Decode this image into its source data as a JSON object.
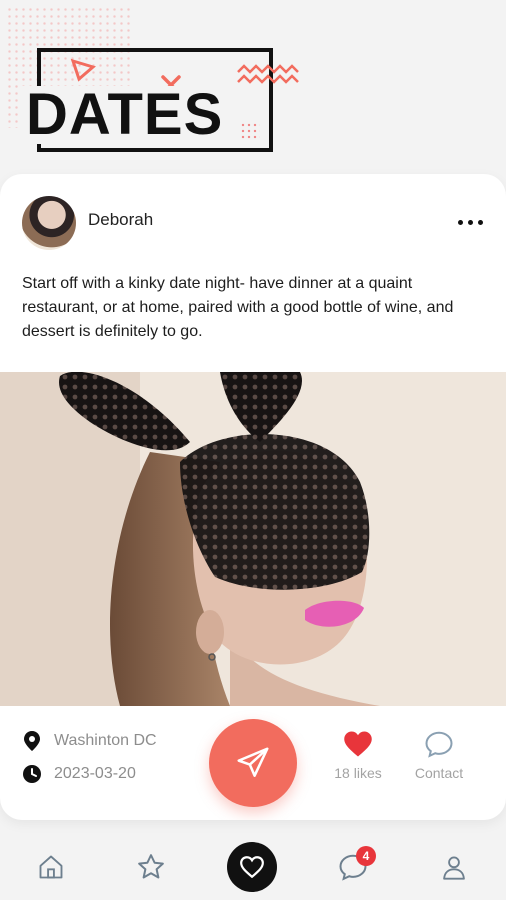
{
  "header": {
    "title": "DATES"
  },
  "post": {
    "author": "Deborah",
    "text": "Start off with a kinky date night- have dinner at a quaint restaurant, or at home, paired with a good bottle of wine, and dessert is definitely to go.",
    "location": "Washinton DC",
    "date": "2023-03-20",
    "likes_label": "18 likes",
    "contact_label": "Contact"
  },
  "nav": {
    "messages_badge": "4"
  },
  "colors": {
    "accent": "#f26c5e",
    "like": "#e8353b",
    "dark": "#111111"
  }
}
